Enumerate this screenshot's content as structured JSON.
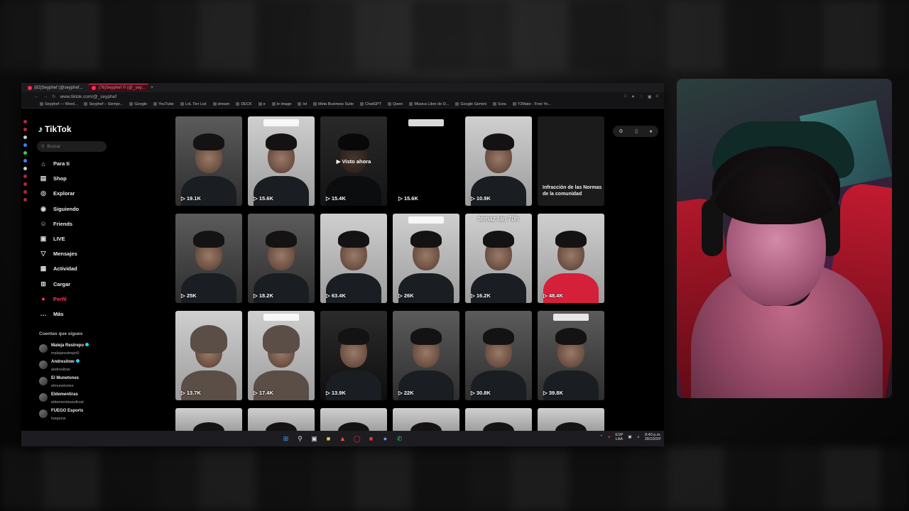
{
  "browser": {
    "tabs": [
      {
        "label": "(82)Seyphef (@seyphef...",
        "active": false
      },
      {
        "label": "(76)Seyphef © (@_sey...",
        "active": true
      }
    ],
    "url": "www.tiktok.com/@_seyphef",
    "bookmarks": [
      "Seyphef — Word...",
      "Seyphef – Siempr...",
      "Google",
      "YouTube",
      "LoL Tier List",
      "stream",
      "DECK",
      "e",
      "le image",
      "lol",
      "Meta Business Suite",
      "ChatGPT",
      "Qwen",
      "Música Libre de D...",
      "Google Gemini",
      "Sora",
      "Y2Mate - Free Yo..."
    ]
  },
  "tiktok": {
    "logo": "TikTok",
    "search_placeholder": "Buscar",
    "nav": [
      {
        "label": "Para ti",
        "icon": "home-icon"
      },
      {
        "label": "Shop",
        "icon": "shop-icon"
      },
      {
        "label": "Explorar",
        "icon": "compass-icon"
      },
      {
        "label": "Siguiendo",
        "icon": "following-icon"
      },
      {
        "label": "Friends",
        "icon": "friends-icon"
      },
      {
        "label": "LIVE",
        "icon": "live-icon"
      },
      {
        "label": "Mensajes",
        "icon": "message-icon"
      },
      {
        "label": "Actividad",
        "icon": "activity-icon"
      },
      {
        "label": "Cargar",
        "icon": "upload-icon"
      },
      {
        "label": "Perfil",
        "icon": "profile-icon",
        "active": true
      },
      {
        "label": "Más",
        "icon": "more-icon"
      }
    ],
    "following_title": "Cuentas que sigues",
    "following": [
      {
        "name": "Maleja Restrepo",
        "handle": "malejarestrepo0",
        "verified": true
      },
      {
        "name": "Andresitow",
        "handle": "andresitow",
        "verified": true
      },
      {
        "name": "El Munetones",
        "handle": "elmunetones",
        "verified": false
      },
      {
        "name": "Eldementiras",
        "handle": "eldementirasoficial",
        "verified": false
      },
      {
        "name": "FUEGO Esports",
        "handle": "fuegocw",
        "verified": false
      }
    ],
    "videos": [
      {
        "views": "19.1K",
        "style": "bg-mid"
      },
      {
        "views": "15.6K",
        "style": "bg-light"
      },
      {
        "views": "15.4K",
        "style": "bg-mid",
        "overlay": "Visto ahora"
      },
      {
        "views": "15.6K",
        "style": "empty"
      },
      {
        "views": "10.9K",
        "style": "bg-light"
      },
      {
        "notice": "Infracción de las Normas de la comunidad"
      },
      {
        "views": "25K",
        "style": "bg-mid"
      },
      {
        "views": "18.2K",
        "style": "bg-mid"
      },
      {
        "views": "63.4K",
        "style": "bg-light"
      },
      {
        "views": "26K",
        "style": "bg-light"
      },
      {
        "views": "16.2K",
        "style": "bg-light",
        "big": "temaz tan 70h"
      },
      {
        "views": "48.4K",
        "style": "bg-light red"
      },
      {
        "views": "13.7K",
        "style": "bg-light hood"
      },
      {
        "views": "17.4K",
        "style": "bg-light hood"
      },
      {
        "views": "13.9K",
        "style": "bg-dark"
      },
      {
        "views": "22K",
        "style": "bg-mid"
      },
      {
        "views": "30.8K",
        "style": "bg-mid"
      },
      {
        "views": "39.8K",
        "style": "bg-mid"
      }
    ]
  },
  "taskbar": {
    "lang_line1": "ESP",
    "lang_line2": "LAA",
    "time": "8:40 p.m.",
    "date": "28/10/20²"
  }
}
